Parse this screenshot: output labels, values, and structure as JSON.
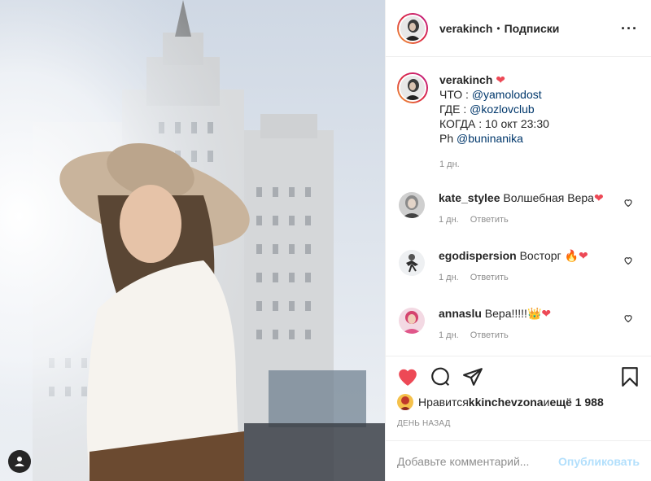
{
  "post": {
    "username": "verakinch",
    "follow_state": "Подписки",
    "separator": "•",
    "more_label": "···"
  },
  "caption": {
    "username": "verakinch",
    "lines": [
      {
        "label": "ЧТО : ",
        "mention": "@yamolodost"
      },
      {
        "label": "ГДЕ : ",
        "mention": "@kozlovclub"
      },
      {
        "label": "КОГДА : 10 окт 23:30",
        "mention": ""
      },
      {
        "label": "Ph ",
        "mention": "@buninanika"
      }
    ],
    "time": "1 дн."
  },
  "comments": [
    {
      "username": "kate_stylee",
      "text": "Волшебная Вера",
      "emoji": "❤",
      "time": "1 дн.",
      "reply": "Ответить"
    },
    {
      "username": "egodispersion",
      "text": "Восторг ",
      "emoji": "🔥❤",
      "time": "1 дн.",
      "reply": "Ответить"
    },
    {
      "username": "annaslu",
      "text": "Вера!!!!!",
      "emoji": "👑❤",
      "time": "1 дн.",
      "reply": "Ответить"
    }
  ],
  "likes": {
    "prefix": "Нравится ",
    "user": "kkinchevzona",
    "middle": " и ",
    "count": "ещё 1 988"
  },
  "date": "ДЕНЬ НАЗАД",
  "add_comment": {
    "placeholder": "Добавьте комментарий...",
    "post_label": "Опубликовать"
  },
  "colors": {
    "like_active": "#ed4956",
    "link": "#00376b",
    "post_button_disabled": "#b2dffc",
    "muted": "#8e8e8e"
  },
  "icons": [
    "heart-filled-icon",
    "comment-icon",
    "share-icon",
    "bookmark-icon",
    "user-tag-icon",
    "heart-outline-icon"
  ]
}
